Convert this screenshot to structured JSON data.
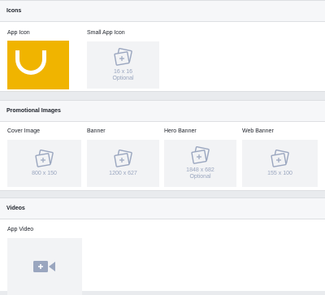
{
  "sections": {
    "icons": {
      "title": "Icons",
      "items": [
        {
          "label": "App Icon",
          "state": "uploaded",
          "color": "#f0b400"
        },
        {
          "label": "Small App Icon",
          "size": "16 x 16",
          "note": "Optional"
        }
      ]
    },
    "promo": {
      "title": "Promotional Images",
      "items": [
        {
          "label": "Cover Image",
          "size": "800 x 150"
        },
        {
          "label": "Banner",
          "size": "1200 x 627"
        },
        {
          "label": "Hero Banner",
          "size": "1848 x 682",
          "note": "Optional"
        },
        {
          "label": "Web Banner",
          "size": "155 x 100"
        }
      ]
    },
    "videos": {
      "title": "Videos",
      "items": [
        {
          "label": "App Video",
          "icon": "video-add-icon"
        }
      ]
    }
  },
  "colors": {
    "placeholder_bg": "#f2f3f5",
    "placeholder_icon": "#9aa6bf",
    "header_bg": "#f6f7f9",
    "page_bg": "#e9ebee"
  }
}
